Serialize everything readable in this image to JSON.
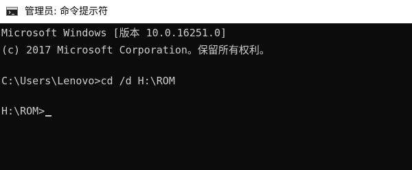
{
  "window": {
    "title": "管理员: 命令提示符",
    "icon": "cmd-icon"
  },
  "console": {
    "lines": [
      "Microsoft Windows [版本 10.0.16251.0]",
      "(c) 2017 Microsoft Corporation。保留所有权利。",
      "C:\\Users\\Lenovo>cd /d H:\\ROM",
      "H:\\ROM>"
    ]
  },
  "colors": {
    "console_background": "#0c0c0c",
    "console_text": "#cccccc",
    "titlebar_background": "#ffffff"
  }
}
